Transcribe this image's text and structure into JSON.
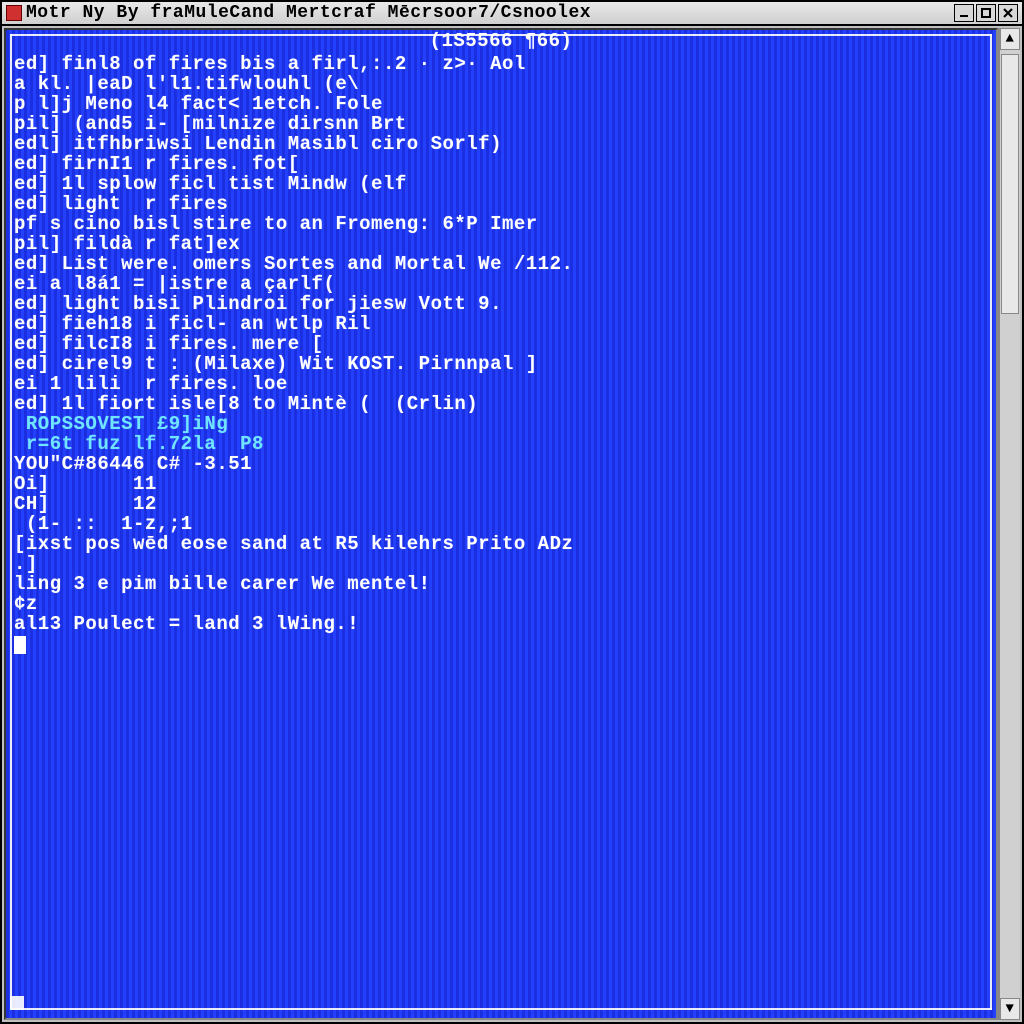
{
  "titlebar": {
    "title": "Motr Ny By fraMuleCand Mertcraf Mēcrsoor7/Csnoolex"
  },
  "terminal": {
    "header": "(1S5566 ¶66)",
    "lines": [
      "ed] finl8 of fires bis a firl,:.2 · z>· Aol",
      "a kl. |eaD l'l1.tifwlouhl (e\\",
      "p l]j Meno l4 fact< 1etch. Fole",
      "pil] (and5 i- [milnize dirsnn Brt",
      "edl] itfhbriwsi Lendin Masibl ciro Sorlf)",
      "ed] firnI1 r fires. fot[",
      "ed] 1l splow ficl tist Mindw (elf",
      "ed] light  r fires",
      "pf s cino bisl stire to an Fromeng: 6*P Imer",
      "pil] fildà r fat]ex",
      "ed] List were. omers Sortes and Mortal We /112.",
      "ei a l8á1 = |istre a çarlf(",
      "ed] light bisi Plindroi for jiesw Vott 9.",
      "ed] fieh18 i ficl- an wtlp Ril",
      "ed] filcI8 i fires. mere [",
      "ed] cirel9 t : (Milaxe) Wit KOST. Pirnnpal ]",
      "ei 1 lili  r fires. loe",
      "ed] 1l fiort isle[8 to Mintè (  (Crlin)",
      " ROPSSOVEST £9]iNg",
      " r=6t fuz lf.72la  P8",
      "YOU\"C#86446 C# -3.51",
      "Oi]       11",
      "CH]       12",
      " (1- ::  1-z,;1",
      "[ixst pos wēd eose sand at R5 kilehrs Prito ADz",
      ".]",
      "ling 3 e pim bille carer We mentel!",
      "¢z",
      "al13 Poulect = land 3 lWing.!"
    ],
    "cyan_line_indices": [
      18,
      19
    ]
  }
}
